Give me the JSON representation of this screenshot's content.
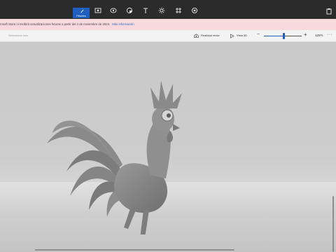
{
  "toolbar_top": {
    "active_tool_label": "Pinceles",
    "tools": [
      "brush-icon",
      "2d-shapes-icon",
      "3d-shapes-icon",
      "stickers-icon",
      "text-icon",
      "effects-icon",
      "canvas-icon",
      "3d-library-icon"
    ]
  },
  "banner": {
    "message": "rosoft Store ni recibirá actualizaciones futuras a partir del 4 de noviembre de 2024.",
    "link": "Más información"
  },
  "toolbar": {
    "select_placeholder": "Seleccionar todo",
    "mixed_reality": "Realidad mixta",
    "view_3d": "Vista 3D",
    "zoom_percent": 0.52,
    "zoom_label": "125%"
  },
  "colors": {
    "accent": "#1f5fbf",
    "banner_bg": "#f8d9dd",
    "topbar_bg": "#2b2b2b"
  }
}
